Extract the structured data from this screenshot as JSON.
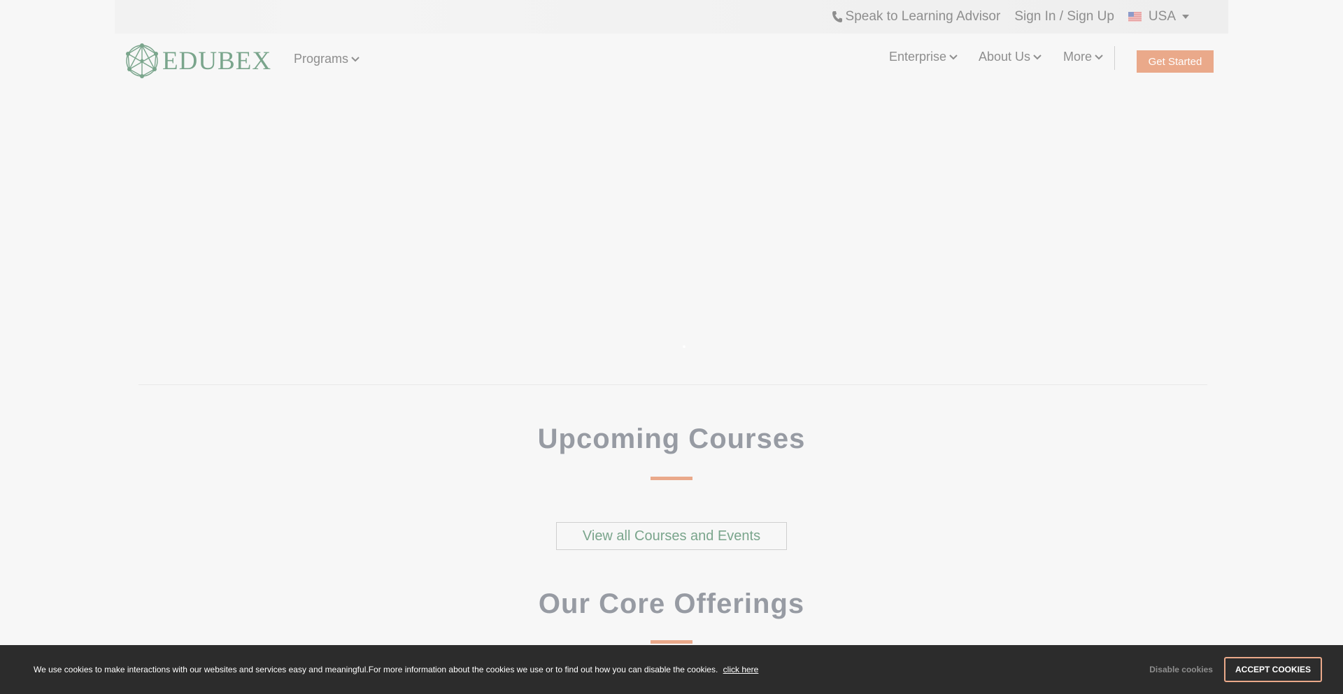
{
  "topbar": {
    "advisor_label": "Speak to Learning Advisor",
    "signin_label": "Sign In / Sign Up",
    "country_label": "USA",
    "icons": {
      "phone": "phone-icon",
      "flag": "us-flag-icon",
      "dropdown": "caret-down-icon"
    }
  },
  "nav": {
    "logo_text": "EDUBEX",
    "programs_label": "Programs",
    "enterprise_label": "Enterprise",
    "about_label": "About Us",
    "more_label": "More",
    "cta_label": "Get Started"
  },
  "sections": {
    "upcoming_title": "Upcoming Courses",
    "view_all_label": "View all Courses and Events",
    "offerings_title": "Our Core Offerings"
  },
  "cookie": {
    "message": "We use cookies to make interactions with our websites and services easy and meaningful.For more information about the cookies we use or to find out how you can disable the cookies.",
    "link_label": "click here",
    "disable_label": "Disable cookies",
    "accept_label": "ACCEPT COOKIES"
  },
  "colors": {
    "brand_green": "#7aa58c",
    "accent_orange": "#eaa98a",
    "cookie_bg": "#2c2c2c",
    "page_bg": "#f7f7f7"
  }
}
